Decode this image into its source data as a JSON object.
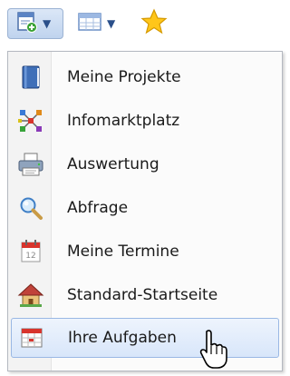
{
  "toolbar": {
    "buttons": [
      {
        "icon": "new-document-icon",
        "has_dropdown": true,
        "pressed": true
      },
      {
        "icon": "table-view-icon",
        "has_dropdown": true,
        "pressed": false
      },
      {
        "icon": "star-icon",
        "has_dropdown": false,
        "pressed": false
      }
    ]
  },
  "menu": {
    "items": [
      {
        "label": "Meine Projekte",
        "icon": "book-icon"
      },
      {
        "label": "Infomarktplatz",
        "icon": "network-icon"
      },
      {
        "label": "Auswertung",
        "icon": "printer-icon"
      },
      {
        "label": "Abfrage",
        "icon": "magnifier-icon"
      },
      {
        "label": "Meine Termine",
        "icon": "calendar-icon"
      },
      {
        "label": "Standard-Startseite",
        "icon": "home-icon"
      },
      {
        "label": "Ihre Aufgaben",
        "icon": "task-calendar-icon",
        "selected": true
      }
    ]
  },
  "colors": {
    "highlight": "#d8e6fa",
    "highlight_border": "#9ab8e4",
    "accent_blue": "#2a5ea8"
  }
}
